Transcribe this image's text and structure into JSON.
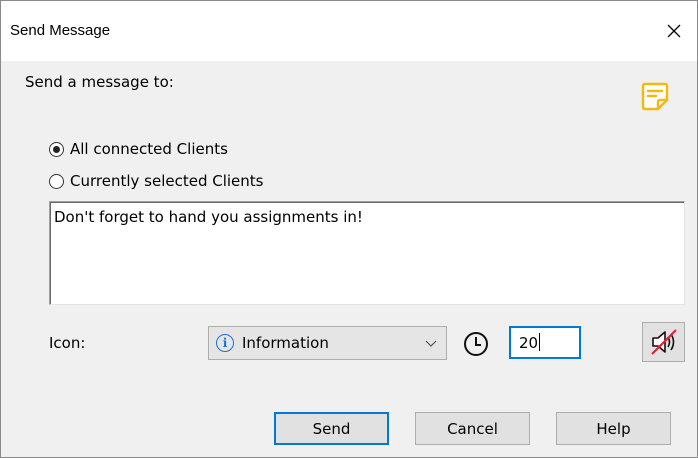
{
  "window": {
    "title": "Send Message"
  },
  "prompt_label": "Send a message to:",
  "recipients": {
    "options": [
      {
        "label": "All connected Clients",
        "selected": true
      },
      {
        "label": "Currently selected Clients",
        "selected": false
      }
    ]
  },
  "message": {
    "value": "Don't forget to hand you assignments in!"
  },
  "icon_row": {
    "label": "Icon:",
    "selected_icon": "Information",
    "timeout_value": "20"
  },
  "buttons": {
    "send": "Send",
    "cancel": "Cancel",
    "help": "Help"
  },
  "icons": {
    "note": "note-icon",
    "info": "info-icon",
    "clock": "clock-icon",
    "mute": "speaker-muted-icon",
    "close": "close-icon"
  },
  "colors": {
    "accent": "#0078d7",
    "note_icon": "#f2b90f",
    "mute_slash": "#e0202a",
    "info": "#1a73d9"
  }
}
